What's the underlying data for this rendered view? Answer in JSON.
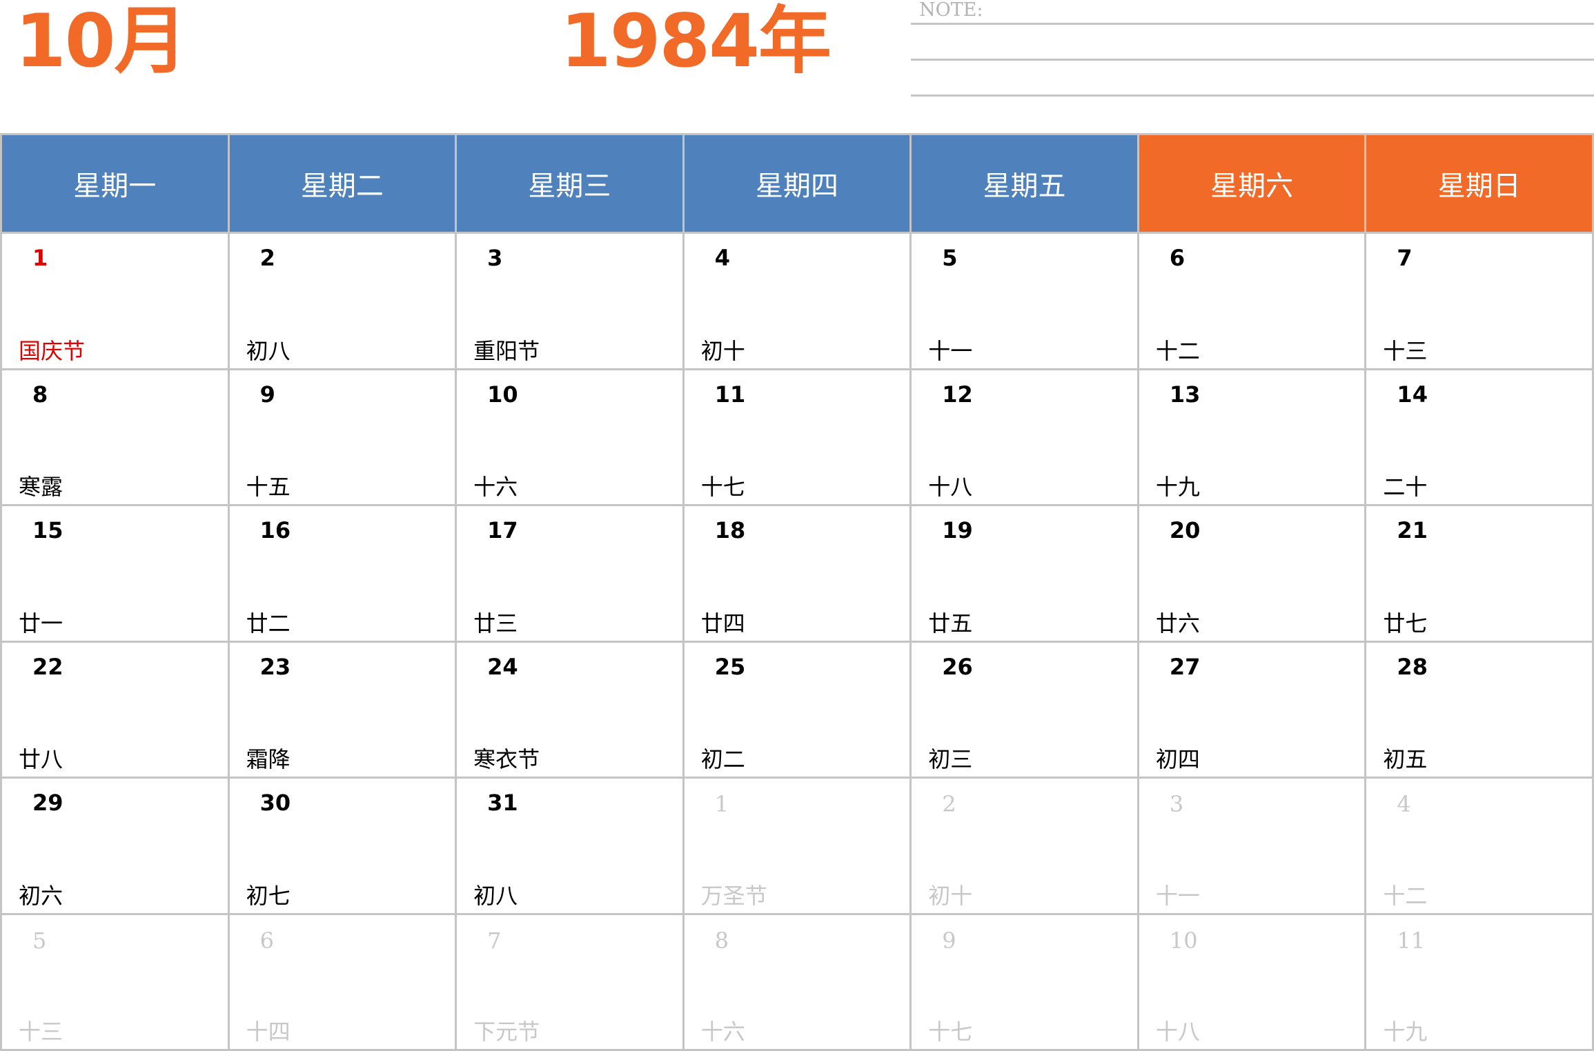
{
  "header": {
    "month": "10月",
    "year": "1984年",
    "note_label": "NOTE:"
  },
  "weekdays": [
    "星期一",
    "星期二",
    "星期三",
    "星期四",
    "星期五",
    "星期六",
    "星期日"
  ],
  "colors": {
    "title": "#f26a27",
    "weekday_header": "#4f81bd",
    "weekend_header": "#f26a27",
    "holiday": "#e00000",
    "other_month": "#c8c8c8"
  },
  "weeks": [
    [
      {
        "day": "1",
        "lunar": "国庆节",
        "holiday": true
      },
      {
        "day": "2",
        "lunar": "初八"
      },
      {
        "day": "3",
        "lunar": "重阳节"
      },
      {
        "day": "4",
        "lunar": "初十"
      },
      {
        "day": "5",
        "lunar": "十一"
      },
      {
        "day": "6",
        "lunar": "十二"
      },
      {
        "day": "7",
        "lunar": "十三"
      }
    ],
    [
      {
        "day": "8",
        "lunar": "寒露"
      },
      {
        "day": "9",
        "lunar": "十五"
      },
      {
        "day": "10",
        "lunar": "十六"
      },
      {
        "day": "11",
        "lunar": "十七"
      },
      {
        "day": "12",
        "lunar": "十八"
      },
      {
        "day": "13",
        "lunar": "十九"
      },
      {
        "day": "14",
        "lunar": "二十"
      }
    ],
    [
      {
        "day": "15",
        "lunar": "廿一"
      },
      {
        "day": "16",
        "lunar": "廿二"
      },
      {
        "day": "17",
        "lunar": "廿三"
      },
      {
        "day": "18",
        "lunar": "廿四"
      },
      {
        "day": "19",
        "lunar": "廿五"
      },
      {
        "day": "20",
        "lunar": "廿六"
      },
      {
        "day": "21",
        "lunar": "廿七"
      }
    ],
    [
      {
        "day": "22",
        "lunar": "廿八"
      },
      {
        "day": "23",
        "lunar": "霜降"
      },
      {
        "day": "24",
        "lunar": "寒衣节"
      },
      {
        "day": "25",
        "lunar": "初二"
      },
      {
        "day": "26",
        "lunar": "初三"
      },
      {
        "day": "27",
        "lunar": "初四"
      },
      {
        "day": "28",
        "lunar": "初五"
      }
    ],
    [
      {
        "day": "29",
        "lunar": "初六"
      },
      {
        "day": "30",
        "lunar": "初七"
      },
      {
        "day": "31",
        "lunar": "初八"
      },
      {
        "day": "1",
        "lunar": "万圣节",
        "other": true
      },
      {
        "day": "2",
        "lunar": "初十",
        "other": true
      },
      {
        "day": "3",
        "lunar": "十一",
        "other": true
      },
      {
        "day": "4",
        "lunar": "十二",
        "other": true
      }
    ],
    [
      {
        "day": "5",
        "lunar": "十三",
        "other": true
      },
      {
        "day": "6",
        "lunar": "十四",
        "other": true
      },
      {
        "day": "7",
        "lunar": "下元节",
        "other": true
      },
      {
        "day": "8",
        "lunar": "十六",
        "other": true
      },
      {
        "day": "9",
        "lunar": "十七",
        "other": true
      },
      {
        "day": "10",
        "lunar": "十八",
        "other": true
      },
      {
        "day": "11",
        "lunar": "十九",
        "other": true
      }
    ]
  ]
}
